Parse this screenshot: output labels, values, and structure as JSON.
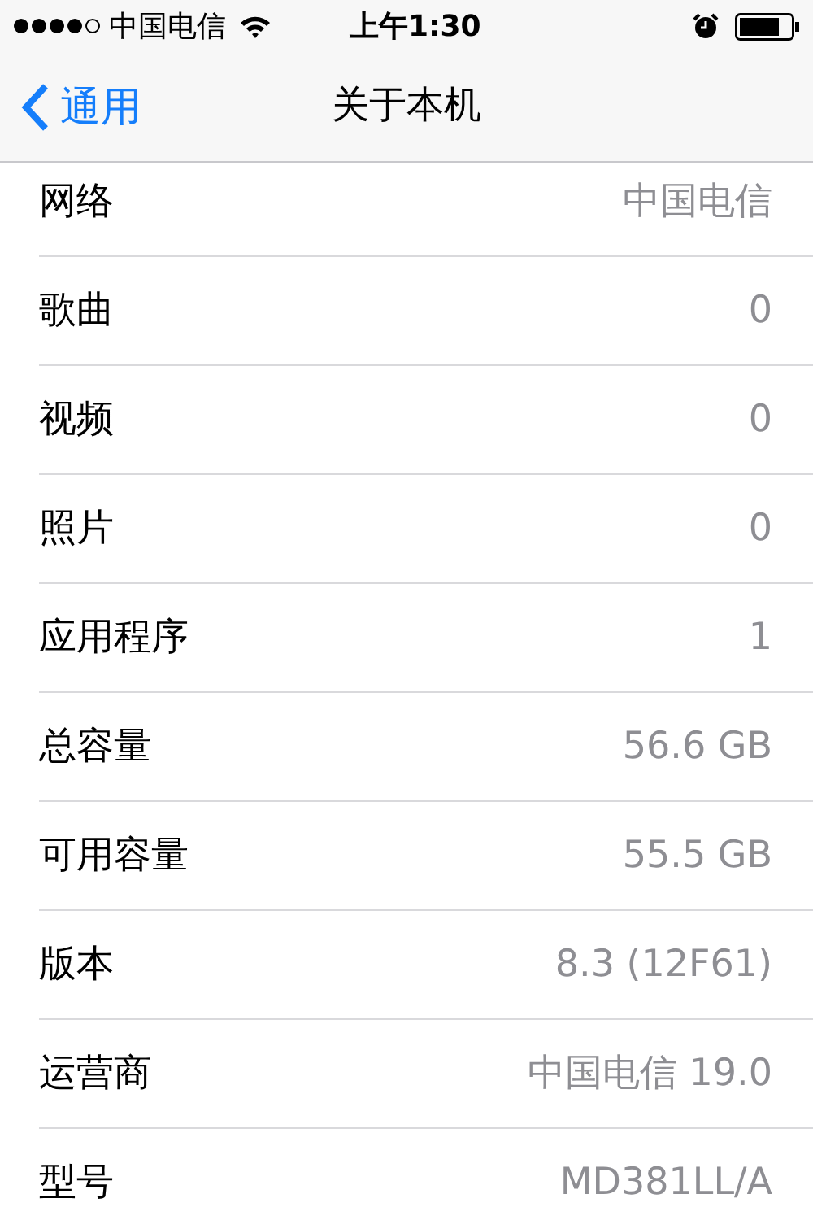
{
  "status_bar": {
    "carrier": "中国电信",
    "time": "上午1:30"
  },
  "nav_bar": {
    "back": "通用",
    "title": "关于本机"
  },
  "rows": [
    {
      "label": "网络",
      "value": "中国电信"
    },
    {
      "label": "歌曲",
      "value": "0"
    },
    {
      "label": "视频",
      "value": "0"
    },
    {
      "label": "照片",
      "value": "0"
    },
    {
      "label": "应用程序",
      "value": "1"
    },
    {
      "label": "总容量",
      "value": "56.6 GB"
    },
    {
      "label": "可用容量",
      "value": "55.5 GB"
    },
    {
      "label": "版本",
      "value": "8.3 (12F61)"
    },
    {
      "label": "运营商",
      "value": "中国电信 19.0"
    },
    {
      "label": "型号",
      "value": "MD381LL/A"
    }
  ]
}
